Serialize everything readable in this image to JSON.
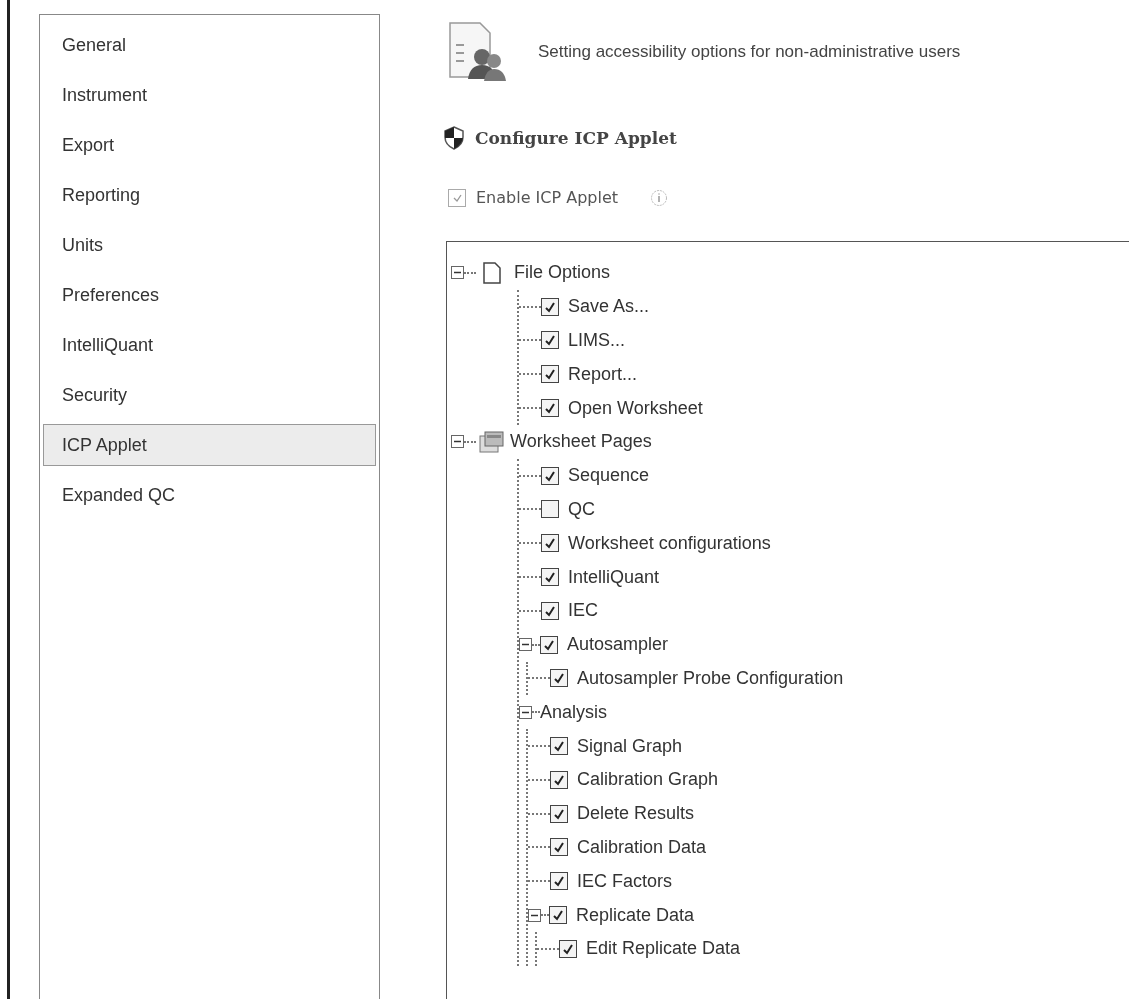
{
  "sidebar": {
    "items": [
      {
        "label": "General",
        "selected": false
      },
      {
        "label": "Instrument",
        "selected": false
      },
      {
        "label": "Export",
        "selected": false
      },
      {
        "label": "Reporting",
        "selected": false
      },
      {
        "label": "Units",
        "selected": false
      },
      {
        "label": "Preferences",
        "selected": false
      },
      {
        "label": "IntelliQuant",
        "selected": false
      },
      {
        "label": "Security",
        "selected": false
      },
      {
        "label": "ICP Applet",
        "selected": true
      },
      {
        "label": "Expanded QC",
        "selected": false
      }
    ]
  },
  "header": {
    "description": "Setting accessibility options for non-administrative users"
  },
  "section": {
    "title": "Configure ICP Applet"
  },
  "enable": {
    "label": "Enable ICP Applet",
    "checked": true
  },
  "tree": [
    {
      "label": "File Options",
      "kind": "file",
      "expanded": true,
      "children": [
        {
          "label": "Save As...",
          "kind": "check",
          "checked": true
        },
        {
          "label": "LIMS...",
          "kind": "check",
          "checked": true
        },
        {
          "label": "Report...",
          "kind": "check",
          "checked": true
        },
        {
          "label": "Open Worksheet",
          "kind": "check",
          "checked": true
        }
      ]
    },
    {
      "label": "Worksheet Pages",
      "kind": "pages",
      "expanded": true,
      "children": [
        {
          "label": "Sequence",
          "kind": "check",
          "checked": true
        },
        {
          "label": "QC",
          "kind": "check",
          "checked": false
        },
        {
          "label": "Worksheet configurations",
          "kind": "check",
          "checked": true
        },
        {
          "label": "IntelliQuant",
          "kind": "check",
          "checked": true
        },
        {
          "label": "IEC",
          "kind": "check",
          "checked": true
        },
        {
          "label": "Autosampler",
          "kind": "check",
          "checked": true,
          "expanded": true,
          "children": [
            {
              "label": "Autosampler Probe Configuration",
              "kind": "check",
              "checked": true
            }
          ]
        },
        {
          "label": "Analysis",
          "kind": "group",
          "expanded": true,
          "children": [
            {
              "label": "Signal Graph",
              "kind": "check",
              "checked": true
            },
            {
              "label": "Calibration Graph",
              "kind": "check",
              "checked": true
            },
            {
              "label": "Delete Results",
              "kind": "check",
              "checked": true
            },
            {
              "label": "Calibration Data",
              "kind": "check",
              "checked": true
            },
            {
              "label": "IEC Factors",
              "kind": "check",
              "checked": true
            },
            {
              "label": "Replicate Data",
              "kind": "check",
              "checked": true,
              "expanded": true,
              "children": [
                {
                  "label": "Edit Replicate Data",
                  "kind": "check",
                  "checked": true
                }
              ]
            }
          ]
        }
      ]
    }
  ]
}
